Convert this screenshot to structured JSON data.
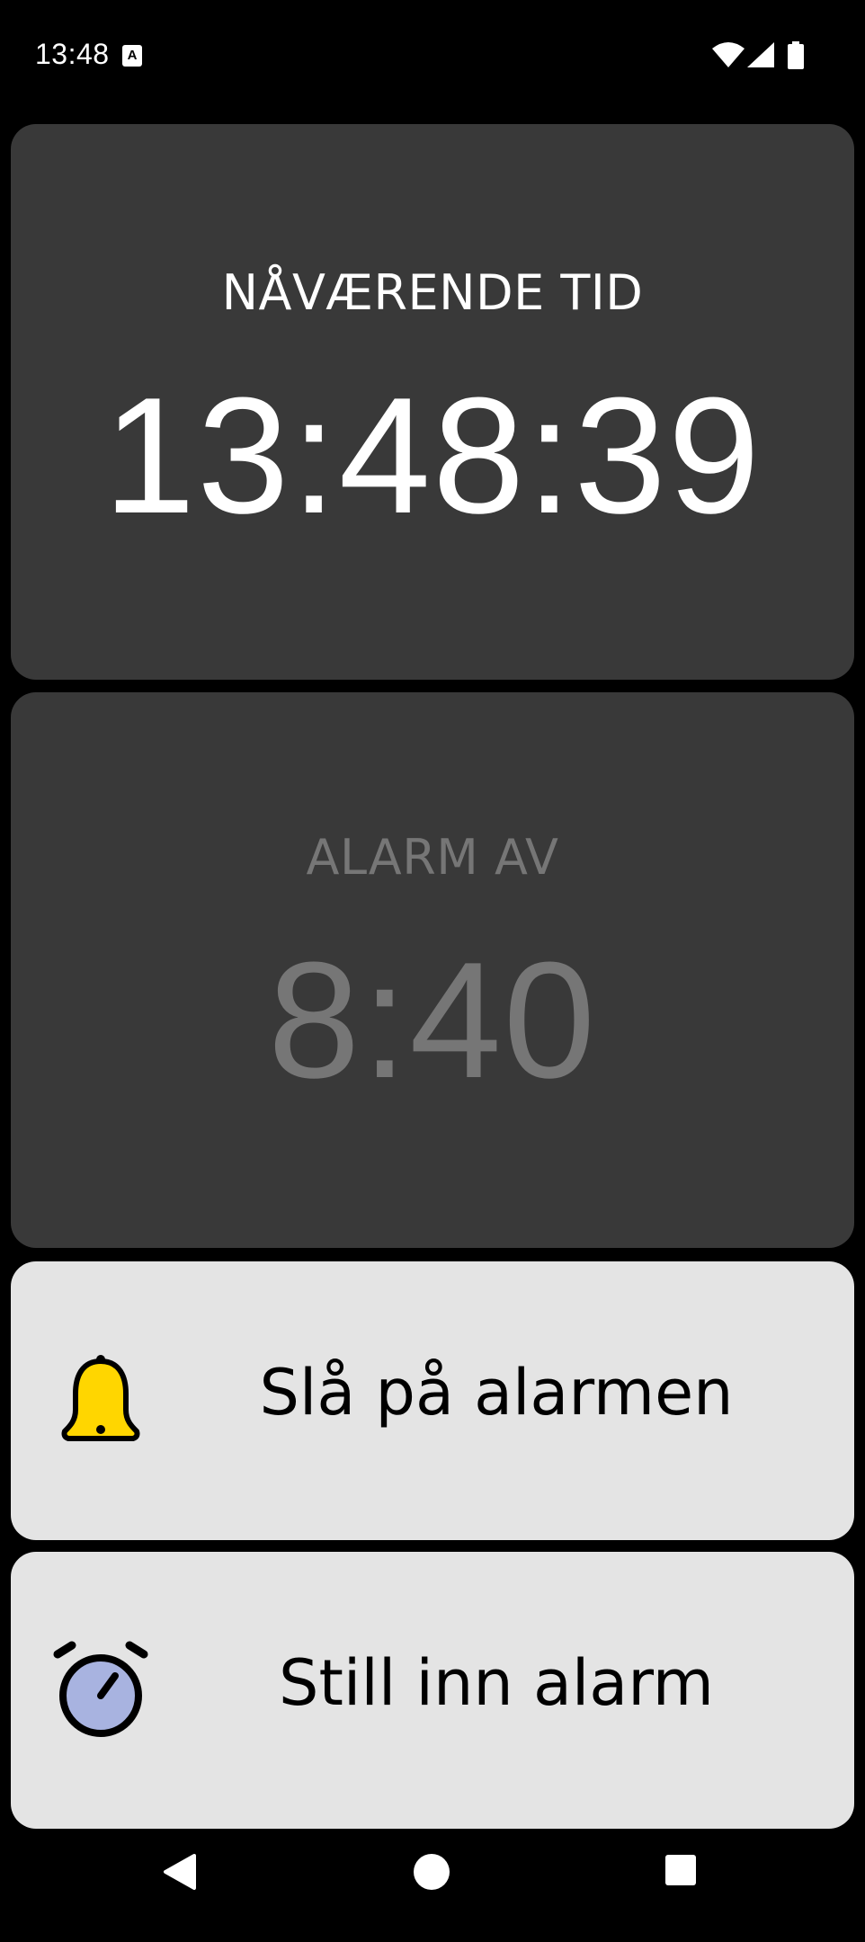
{
  "status_bar": {
    "time": "13:48",
    "notification_icon_letter": "A",
    "icons": [
      "wifi-icon",
      "signal-icon",
      "battery-icon"
    ]
  },
  "current_time": {
    "label": "NÅVÆRENDE TID",
    "value": "13:48:39"
  },
  "alarm": {
    "label": "ALARM AV",
    "value": "8:40"
  },
  "buttons": {
    "toggle_alarm": {
      "label": "Slå på alarmen",
      "icon": "bell-icon",
      "icon_color": "#FFD600"
    },
    "set_alarm": {
      "label": "Still inn alarm",
      "icon": "alarm-clock-icon",
      "icon_color": "#A8B3E0"
    }
  },
  "nav_bar": {
    "icons": [
      "back-icon",
      "home-icon",
      "recents-icon"
    ]
  },
  "colors": {
    "background": "#000000",
    "panel_dark": "#393939",
    "panel_light": "#E4E4E4",
    "alarm_off_text": "#767676"
  }
}
